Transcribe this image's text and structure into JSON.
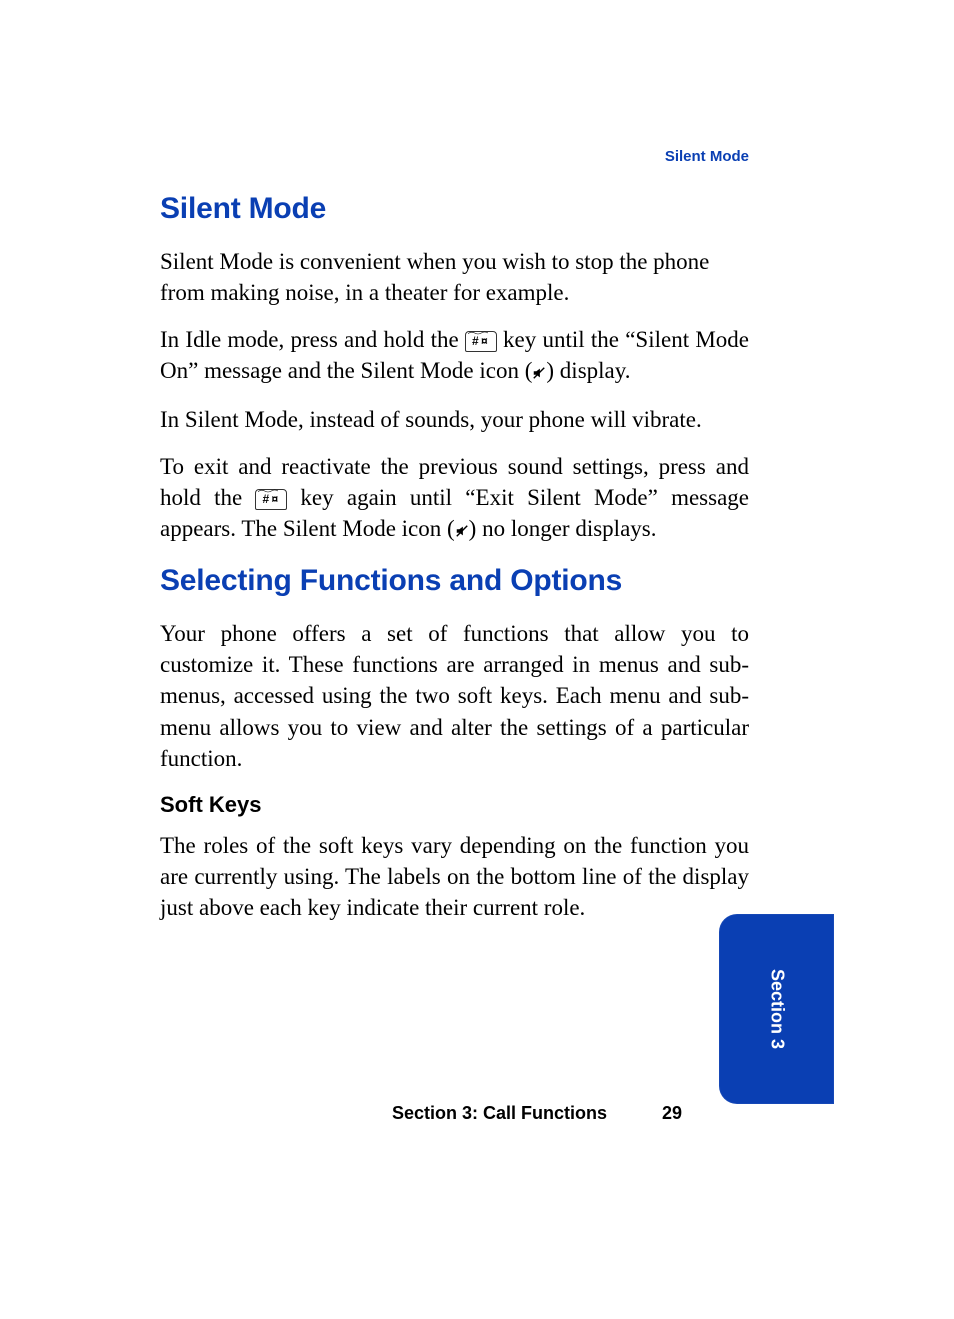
{
  "header": {
    "topic": "Silent Mode"
  },
  "h1a": "Silent Mode",
  "p1": "Silent Mode is convenient when you wish to stop the phone from making noise, in a theater for example.",
  "p2a": "In Idle mode, press and hold the ",
  "p2b": " key until the “Silent Mode On” message and the Silent Mode icon (",
  "p2c": ") display.",
  "p3": "In Silent Mode, instead of sounds, your phone will vibrate.",
  "p4a": "To exit and reactivate the previous sound settings, press and hold the ",
  "p4b": " key again until “Exit Silent Mode” message appears. The Silent Mode icon (",
  "p4c": ") no longer displays.",
  "h1b": "Selecting Functions and Options",
  "p5": "Your phone offers a set of functions that allow you to customize it. These functions are arranged in menus and sub-menus, accessed using the two soft keys. Each menu and sub-menu allows you to view and alter the settings of a particular function.",
  "h2a": "Soft Keys",
  "p6": "The roles of the soft keys vary depending on the function you are currently using. The labels on the bottom line of the display just above each key indicate their current role.",
  "footer": {
    "section": "Section 3: Call Functions",
    "page": "29"
  },
  "tab": {
    "label": "Section 3"
  },
  "key": {
    "glyph": "# ¤"
  }
}
